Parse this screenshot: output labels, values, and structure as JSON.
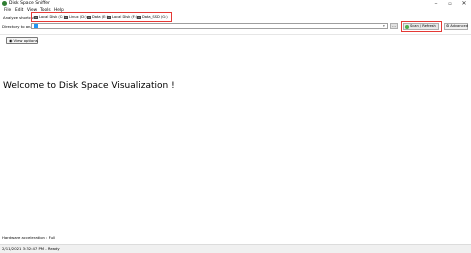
{
  "window": {
    "title": "Disk Space Sniffer",
    "minimize": "–",
    "maximize": "▫",
    "close": "✕"
  },
  "menu": [
    "File",
    "Edit",
    "View",
    "Tools",
    "Help"
  ],
  "shortcuts": {
    "label": "Analyze shortcuts",
    "drives": [
      "Local Disk (C:)",
      "Linux (D:)",
      "Data (E:)",
      "Local Disk (F:)",
      "Data_SSD (G:)"
    ]
  },
  "directory": {
    "label": "Directory to analyze",
    "value": "",
    "browse_label": "...",
    "dropdown_icon": "▾"
  },
  "scan": {
    "label": "Scan / Refresh"
  },
  "advanced": {
    "label": "Advanced",
    "icon": "⚙"
  },
  "view_options": {
    "label": "View options",
    "icon": "◉"
  },
  "main": {
    "welcome": "Welcome to Disk Space Visualization !"
  },
  "hardware": {
    "text": "Hardware acceleration : Full"
  },
  "status": {
    "text": "2/11/2021 3:32:47 PM - Ready"
  },
  "colors": {
    "highlight_box": "#e53935",
    "scan_icon": "#4caf50",
    "caret": "#2196f3"
  }
}
